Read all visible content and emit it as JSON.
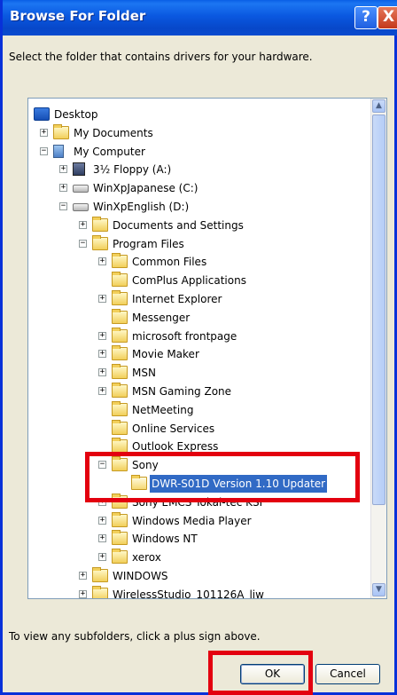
{
  "window": {
    "title": "Browse For Folder"
  },
  "titlebar_buttons": {
    "help": "?",
    "close": "X"
  },
  "prompt": "Select the folder that contains drivers for your hardware.",
  "tree": [
    {
      "label": "Desktop",
      "icon": "desktop-icon",
      "expander": ""
    },
    {
      "label": "My Documents",
      "icon": "folder-icon",
      "expander": "+"
    },
    {
      "label": "My Computer",
      "icon": "computer-icon",
      "expander": "-"
    },
    {
      "label": "3½ Floppy (A:)",
      "icon": "floppy-icon",
      "expander": "+"
    },
    {
      "label": "WinXpJapanese (C:)",
      "icon": "drive-icon",
      "expander": "+"
    },
    {
      "label": "WinXpEnglish (D:)",
      "icon": "drive-icon",
      "expander": "-"
    },
    {
      "label": "Documents and Settings",
      "icon": "folder-icon",
      "expander": "+"
    },
    {
      "label": "Program Files",
      "icon": "folder-icon",
      "expander": "-"
    },
    {
      "label": "Common Files",
      "icon": "folder-icon",
      "expander": "+"
    },
    {
      "label": "ComPlus Applications",
      "icon": "folder-icon",
      "expander": ""
    },
    {
      "label": "Internet Explorer",
      "icon": "folder-icon",
      "expander": "+"
    },
    {
      "label": "Messenger",
      "icon": "folder-icon",
      "expander": ""
    },
    {
      "label": "microsoft frontpage",
      "icon": "folder-icon",
      "expander": "+"
    },
    {
      "label": "Movie Maker",
      "icon": "folder-icon",
      "expander": "+"
    },
    {
      "label": "MSN",
      "icon": "folder-icon",
      "expander": "+"
    },
    {
      "label": "MSN Gaming Zone",
      "icon": "folder-icon",
      "expander": "+"
    },
    {
      "label": "NetMeeting",
      "icon": "folder-icon",
      "expander": ""
    },
    {
      "label": "Online Services",
      "icon": "folder-icon",
      "expander": ""
    },
    {
      "label": "Outlook Express",
      "icon": "folder-icon",
      "expander": ""
    },
    {
      "label": "Sony",
      "icon": "folder-icon",
      "expander": "-"
    },
    {
      "label": "DWR-S01D Version 1.10 Updater",
      "icon": "open-folder-icon",
      "expander": "",
      "selected": true
    },
    {
      "label": "Sony EMCS Tokai-tec KSI",
      "icon": "folder-icon",
      "expander": "+"
    },
    {
      "label": "Windows Media Player",
      "icon": "folder-icon",
      "expander": "+"
    },
    {
      "label": "Windows NT",
      "icon": "folder-icon",
      "expander": "+"
    },
    {
      "label": "xerox",
      "icon": "folder-icon",
      "expander": "+"
    },
    {
      "label": "WINDOWS",
      "icon": "folder-icon",
      "expander": "+"
    },
    {
      "label": "WirelessStudio_101126A_liw",
      "icon": "folder-icon",
      "expander": "+"
    }
  ],
  "hint": "To view any subfolders, click a plus sign above.",
  "buttons": {
    "ok": "OK",
    "cancel": "Cancel"
  },
  "colors": {
    "highlight": "#e3000f",
    "selection": "#316ac5"
  }
}
